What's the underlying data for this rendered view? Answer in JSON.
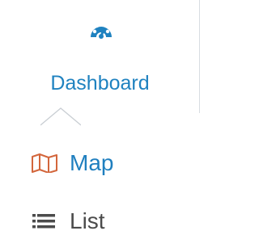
{
  "nav": {
    "dashboard": {
      "label": "Dashboard",
      "icon": "dashboard-gauge-icon",
      "color": "#1f82c0"
    }
  },
  "menu": {
    "items": [
      {
        "label": "Map",
        "icon": "map-icon",
        "color": "#1f7fbf",
        "icon_color": "#d3663c"
      },
      {
        "label": "List",
        "icon": "list-icon",
        "color": "#4b4b4b"
      }
    ]
  }
}
